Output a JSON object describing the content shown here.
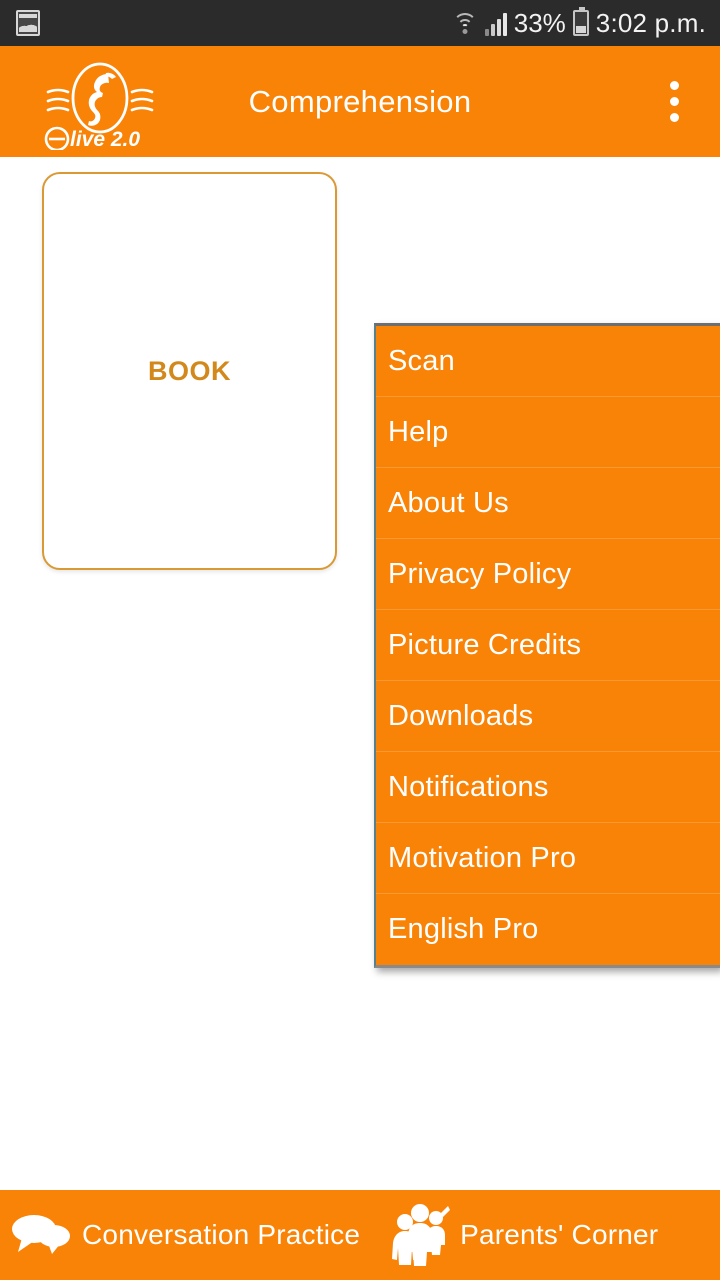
{
  "status_bar": {
    "notification_icon": "photo-icon",
    "wifi_icon": "wifi-icon",
    "signal_icon": "cellular-signal-icon",
    "battery_percent": "33%",
    "battery_icon": "battery-icon",
    "time": "3:02 p.m."
  },
  "app_bar": {
    "logo_alt": "elive-2.0-seahorse-logo",
    "logo_text": "live 2.0",
    "logo_mark": "e",
    "title": "Comprehension",
    "overflow_icon": "overflow-menu-icon"
  },
  "main": {
    "book_card": {
      "label": "BOOK"
    }
  },
  "popup_menu": {
    "visible": true,
    "items": [
      {
        "label": "Scan"
      },
      {
        "label": "Help"
      },
      {
        "label": "About Us"
      },
      {
        "label": "Privacy Policy"
      },
      {
        "label": "Picture Credits"
      },
      {
        "label": "Downloads"
      },
      {
        "label": "Notifications"
      },
      {
        "label": "Motivation Pro"
      },
      {
        "label": "English Pro"
      }
    ]
  },
  "bottom_bar": {
    "left": {
      "icon": "speech-bubbles-icon",
      "label": "Conversation Practice"
    },
    "right": {
      "icon": "family-icon",
      "label": "Parents' Corner"
    }
  },
  "colors": {
    "brand_orange": "#f98307",
    "status_bar_bg": "#2b2b2b",
    "card_border": "#d99a36",
    "card_label": "#d2881b",
    "page_bg": "#ffffff",
    "menu_edge_teal": "#55808c"
  }
}
